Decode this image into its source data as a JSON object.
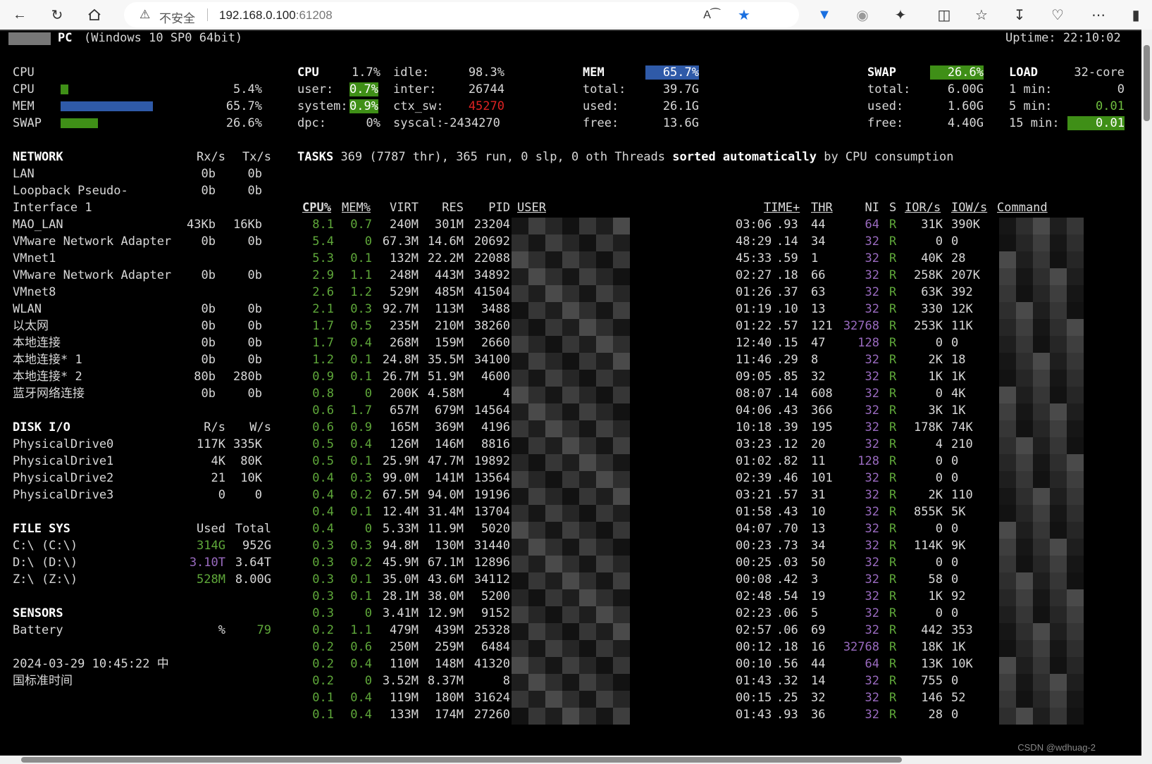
{
  "browser": {
    "security_label": "不安全",
    "url_host": "192.168.0.100",
    "url_port": ":61208"
  },
  "header": {
    "host_suffix": "PC",
    "os": "(Windows 10 SP0 64bit)",
    "uptime": "Uptime: 22:10:02"
  },
  "quicklook": {
    "title": "CPU",
    "rows": [
      {
        "label": "CPU",
        "value": "5.4%",
        "fill": 0.054,
        "color": "#3f8f17"
      },
      {
        "label": "MEM",
        "value": "65.7%",
        "fill": 0.657,
        "color": "#2f5aa8"
      },
      {
        "label": "SWAP",
        "value": "26.6%",
        "fill": 0.266,
        "color": "#3f8f17"
      }
    ]
  },
  "cpu": {
    "title": "CPU",
    "total": "1.7%",
    "user_label": "user:",
    "user": "0.7%",
    "system_label": "system:",
    "system": "0.9%",
    "dpc_label": "dpc:",
    "dpc": "0%",
    "idle_label": "idle:",
    "idle": "98.3%",
    "inter_label": "inter:",
    "inter": "26744",
    "ctx_label": "ctx_sw:",
    "ctx": "45270",
    "syscal_label": "syscal:",
    "syscal": "-2434270"
  },
  "mem": {
    "title": "MEM",
    "percent": "65.7%",
    "total_label": "total:",
    "total": "39.7G",
    "used_label": "used:",
    "used": "26.1G",
    "free_label": "free:",
    "free": "13.6G"
  },
  "swap": {
    "title": "SWAP",
    "percent": "26.6%",
    "total_label": "total:",
    "total": "6.00G",
    "used_label": "used:",
    "used": "1.60G",
    "free_label": "free:",
    "free": "4.40G"
  },
  "load": {
    "title": "LOAD",
    "cores": "32-core",
    "m1_label": "1 min:",
    "m1": "0",
    "m5_label": "5 min:",
    "m5": "0.01",
    "m15_label": "15 min:",
    "m15": "0.01"
  },
  "network": {
    "title": "NETWORK",
    "rx": "Rx/s",
    "tx": "Tx/s",
    "rows": [
      {
        "name": "LAN",
        "rx": "0b",
        "tx": "0b"
      },
      {
        "name": "Loopback Pseudo-",
        "rx": "0b",
        "tx": "0b"
      },
      {
        "name": "Interface 1",
        "rx": "",
        "tx": ""
      },
      {
        "name": "MAO_LAN",
        "rx": "43Kb",
        "tx": "16Kb"
      },
      {
        "name": "VMware Network Adapter",
        "rx": "0b",
        "tx": "0b"
      },
      {
        "name": "VMnet1",
        "rx": "",
        "tx": ""
      },
      {
        "name": "VMware Network Adapter",
        "rx": "0b",
        "tx": "0b"
      },
      {
        "name": "VMnet8",
        "rx": "",
        "tx": ""
      },
      {
        "name": "WLAN",
        "rx": "0b",
        "tx": "0b"
      },
      {
        "name": "以太网",
        "rx": "0b",
        "tx": "0b"
      },
      {
        "name": "本地连接",
        "rx": "0b",
        "tx": "0b"
      },
      {
        "name": "本地连接* 1",
        "rx": "0b",
        "tx": "0b"
      },
      {
        "name": "本地连接* 2",
        "rx": "80b",
        "tx": "280b"
      },
      {
        "name": "蓝牙网络连接",
        "rx": "0b",
        "tx": "0b"
      }
    ]
  },
  "disk": {
    "title": "DISK I/O",
    "r": "R/s",
    "w": "W/s",
    "rows": [
      {
        "name": "PhysicalDrive0",
        "r": "117K",
        "w": "335K"
      },
      {
        "name": "PhysicalDrive1",
        "r": "4K",
        "w": "80K"
      },
      {
        "name": "PhysicalDrive2",
        "r": "21",
        "w": "10K"
      },
      {
        "name": "PhysicalDrive3",
        "r": "0",
        "w": "0"
      }
    ]
  },
  "fs": {
    "title": "FILE SYS",
    "used": "Used",
    "total": "Total",
    "rows": [
      {
        "name": "C:\\ (C:\\)",
        "used": "314G",
        "total": "952G",
        "color": "#5fa83a"
      },
      {
        "name": "D:\\ (D:\\)",
        "used": "3.10T",
        "total": "3.64T",
        "color": "#9a6bc0"
      },
      {
        "name": "Z:\\ (Z:\\)",
        "used": "528M",
        "total": "8.00G",
        "color": "#5fa83a"
      }
    ]
  },
  "sensors": {
    "title": "SENSORS",
    "battery_label": "Battery",
    "battery_unit": "%",
    "battery": "79"
  },
  "datetime": {
    "line1": "2024-03-29 10:45:22 中",
    "line2": "国标准时间"
  },
  "tasks": {
    "title": "TASKS",
    "summary": "369 (7787 thr), 365 run, 0 slp, 0 oth Threads",
    "sorted": "sorted automatically",
    "by": "by CPU consumption"
  },
  "proc_headers": {
    "cpu": "CPU%",
    "mem": "MEM%",
    "virt": "VIRT",
    "res": "RES",
    "pid": "PID",
    "user": "USER",
    "time": "TIME+",
    "thr": "THR",
    "ni": "NI",
    "s": "S",
    "ior": "IOR/s",
    "iow": "IOW/s",
    "cmd": "Command"
  },
  "processes": [
    {
      "cpu": "8.1",
      "mem": "0.7",
      "virt": "240M",
      "res": "301M",
      "pid": "23204",
      "tm": "03:06",
      "tf": ".93",
      "thr": "44",
      "ni": "64",
      "s": "R",
      "ior": "31K",
      "iow": "390K"
    },
    {
      "cpu": "5.4",
      "mem": "0",
      "virt": "67.3M",
      "res": "14.6M",
      "pid": "20692",
      "tm": "48:29",
      "tf": ".14",
      "thr": "34",
      "ni": "32",
      "s": "R",
      "ior": "0",
      "iow": "0"
    },
    {
      "cpu": "5.3",
      "mem": "0.1",
      "virt": "132M",
      "res": "22.2M",
      "pid": "22088",
      "tm": "45:33",
      "tf": ".59",
      "thr": "1",
      "ni": "32",
      "s": "R",
      "ior": "40K",
      "iow": "28"
    },
    {
      "cpu": "2.9",
      "mem": "1.1",
      "virt": "248M",
      "res": "443M",
      "pid": "34892",
      "tm": "02:27",
      "tf": ".18",
      "thr": "66",
      "ni": "32",
      "s": "R",
      "ior": "258K",
      "iow": "207K"
    },
    {
      "cpu": "2.6",
      "mem": "1.2",
      "virt": "529M",
      "res": "485M",
      "pid": "41504",
      "tm": "01:26",
      "tf": ".37",
      "thr": "63",
      "ni": "32",
      "s": "R",
      "ior": "63K",
      "iow": "392"
    },
    {
      "cpu": "2.1",
      "mem": "0.3",
      "virt": "92.7M",
      "res": "113M",
      "pid": "3488",
      "tm": "01:19",
      "tf": ".10",
      "thr": "13",
      "ni": "32",
      "s": "R",
      "ior": "330",
      "iow": "12K"
    },
    {
      "cpu": "1.7",
      "mem": "0.5",
      "virt": "235M",
      "res": "210M",
      "pid": "38260",
      "tm": "01:22",
      "tf": ".57",
      "thr": "121",
      "ni": "32768",
      "s": "R",
      "ior": "253K",
      "iow": "11K"
    },
    {
      "cpu": "1.7",
      "mem": "0.4",
      "virt": "268M",
      "res": "159M",
      "pid": "2660",
      "tm": "12:40",
      "tf": ".15",
      "thr": "47",
      "ni": "128",
      "s": "R",
      "ior": "0",
      "iow": "0"
    },
    {
      "cpu": "1.2",
      "mem": "0.1",
      "virt": "24.8M",
      "res": "35.5M",
      "pid": "34100",
      "tm": "11:46",
      "tf": ".29",
      "thr": "8",
      "ni": "32",
      "s": "R",
      "ior": "2K",
      "iow": "18"
    },
    {
      "cpu": "0.9",
      "mem": "0.1",
      "virt": "26.7M",
      "res": "51.9M",
      "pid": "4600",
      "tm": "09:05",
      "tf": ".85",
      "thr": "32",
      "ni": "32",
      "s": "R",
      "ior": "1K",
      "iow": "1K"
    },
    {
      "cpu": "0.8",
      "mem": "0",
      "virt": "200K",
      "res": "4.58M",
      "pid": "4",
      "tm": "08:07",
      "tf": ".14",
      "thr": "608",
      "ni": "32",
      "s": "R",
      "ior": "0",
      "iow": "4K"
    },
    {
      "cpu": "0.6",
      "mem": "1.7",
      "virt": "657M",
      "res": "679M",
      "pid": "14564",
      "tm": "04:06",
      "tf": ".43",
      "thr": "366",
      "ni": "32",
      "s": "R",
      "ior": "3K",
      "iow": "1K"
    },
    {
      "cpu": "0.6",
      "mem": "0.9",
      "virt": "165M",
      "res": "369M",
      "pid": "4196",
      "tm": "10:18",
      "tf": ".39",
      "thr": "195",
      "ni": "32",
      "s": "R",
      "ior": "178K",
      "iow": "74K"
    },
    {
      "cpu": "0.5",
      "mem": "0.4",
      "virt": "126M",
      "res": "146M",
      "pid": "8816",
      "tm": "03:23",
      "tf": ".12",
      "thr": "20",
      "ni": "32",
      "s": "R",
      "ior": "4",
      "iow": "210"
    },
    {
      "cpu": "0.5",
      "mem": "0.1",
      "virt": "25.9M",
      "res": "47.7M",
      "pid": "19892",
      "tm": "01:02",
      "tf": ".82",
      "thr": "11",
      "ni": "128",
      "s": "R",
      "ior": "0",
      "iow": "0"
    },
    {
      "cpu": "0.4",
      "mem": "0.3",
      "virt": "99.0M",
      "res": "141M",
      "pid": "13564",
      "tm": "02:39",
      "tf": ".46",
      "thr": "101",
      "ni": "32",
      "s": "R",
      "ior": "0",
      "iow": "0"
    },
    {
      "cpu": "0.4",
      "mem": "0.2",
      "virt": "67.5M",
      "res": "94.0M",
      "pid": "19196",
      "tm": "03:21",
      "tf": ".57",
      "thr": "31",
      "ni": "32",
      "s": "R",
      "ior": "2K",
      "iow": "110"
    },
    {
      "cpu": "0.4",
      "mem": "0.1",
      "virt": "12.4M",
      "res": "31.4M",
      "pid": "13704",
      "tm": "01:58",
      "tf": ".43",
      "thr": "10",
      "ni": "32",
      "s": "R",
      "ior": "855K",
      "iow": "5K"
    },
    {
      "cpu": "0.4",
      "mem": "0",
      "virt": "5.33M",
      "res": "11.9M",
      "pid": "5020",
      "tm": "04:07",
      "tf": ".70",
      "thr": "13",
      "ni": "32",
      "s": "R",
      "ior": "0",
      "iow": "0"
    },
    {
      "cpu": "0.3",
      "mem": "0.3",
      "virt": "94.8M",
      "res": "130M",
      "pid": "31440",
      "tm": "00:23",
      "tf": ".73",
      "thr": "34",
      "ni": "32",
      "s": "R",
      "ior": "114K",
      "iow": "9K"
    },
    {
      "cpu": "0.3",
      "mem": "0.2",
      "virt": "45.9M",
      "res": "67.1M",
      "pid": "12896",
      "tm": "00:25",
      "tf": ".03",
      "thr": "50",
      "ni": "32",
      "s": "R",
      "ior": "0",
      "iow": "0"
    },
    {
      "cpu": "0.3",
      "mem": "0.1",
      "virt": "35.0M",
      "res": "43.6M",
      "pid": "34112",
      "tm": "00:08",
      "tf": ".42",
      "thr": "3",
      "ni": "32",
      "s": "R",
      "ior": "58",
      "iow": "0"
    },
    {
      "cpu": "0.3",
      "mem": "0.1",
      "virt": "28.1M",
      "res": "38.0M",
      "pid": "5200",
      "tm": "02:48",
      "tf": ".54",
      "thr": "19",
      "ni": "32",
      "s": "R",
      "ior": "1K",
      "iow": "92"
    },
    {
      "cpu": "0.3",
      "mem": "0",
      "virt": "3.41M",
      "res": "12.9M",
      "pid": "9152",
      "tm": "02:23",
      "tf": ".06",
      "thr": "5",
      "ni": "32",
      "s": "R",
      "ior": "0",
      "iow": "0"
    },
    {
      "cpu": "0.2",
      "mem": "1.1",
      "virt": "479M",
      "res": "439M",
      "pid": "25328",
      "tm": "02:57",
      "tf": ".06",
      "thr": "69",
      "ni": "32",
      "s": "R",
      "ior": "442",
      "iow": "353"
    },
    {
      "cpu": "0.2",
      "mem": "0.6",
      "virt": "250M",
      "res": "259M",
      "pid": "6484",
      "tm": "00:12",
      "tf": ".18",
      "thr": "16",
      "ni": "32768",
      "s": "R",
      "ior": "18K",
      "iow": "1K"
    },
    {
      "cpu": "0.2",
      "mem": "0.4",
      "virt": "110M",
      "res": "148M",
      "pid": "41320",
      "tm": "00:10",
      "tf": ".56",
      "thr": "44",
      "ni": "64",
      "s": "R",
      "ior": "13K",
      "iow": "10K"
    },
    {
      "cpu": "0.2",
      "mem": "0",
      "virt": "3.52M",
      "res": "8.37M",
      "pid": "8",
      "tm": "01:43",
      "tf": ".32",
      "thr": "14",
      "ni": "32",
      "s": "R",
      "ior": "755",
      "iow": "0"
    },
    {
      "cpu": "0.1",
      "mem": "0.4",
      "virt": "119M",
      "res": "180M",
      "pid": "31624",
      "tm": "00:15",
      "tf": ".25",
      "thr": "32",
      "ni": "32",
      "s": "R",
      "ior": "146",
      "iow": "52"
    },
    {
      "cpu": "0.1",
      "mem": "0.4",
      "virt": "133M",
      "res": "174M",
      "pid": "27260",
      "tm": "01:43",
      "tf": ".93",
      "thr": "36",
      "ni": "32",
      "s": "R",
      "ior": "28",
      "iow": "0"
    }
  ],
  "watermark": "CSDN @wdhuag-2"
}
